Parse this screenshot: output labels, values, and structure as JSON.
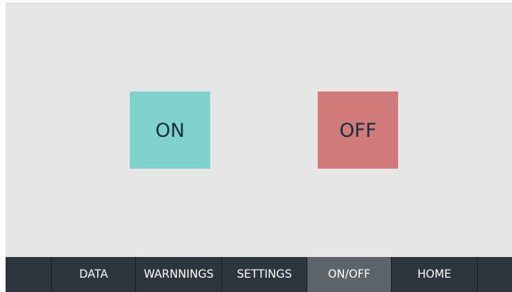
{
  "controls": {
    "on_label": "ON",
    "off_label": "OFF",
    "on_color": "#80d2cc",
    "off_color": "#d07b7a"
  },
  "nav": {
    "items": [
      {
        "label": ""
      },
      {
        "label": "DATA"
      },
      {
        "label": "WARNNINGS"
      },
      {
        "label": "SETTINGS"
      },
      {
        "label": "ON/OFF",
        "active": true
      },
      {
        "label": "HOME"
      },
      {
        "label": ""
      }
    ],
    "background": "#2d353d",
    "active_background": "#5d6469"
  }
}
